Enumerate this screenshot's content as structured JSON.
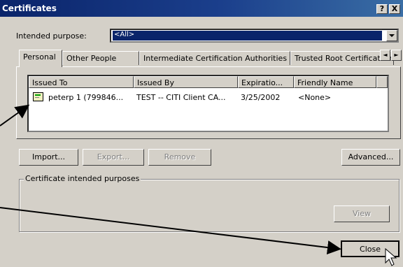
{
  "window": {
    "title": "Certificates",
    "help_label": "?",
    "close_label": "X"
  },
  "purpose": {
    "label": "Intended purpose:",
    "value": "<All>"
  },
  "tabs": [
    {
      "label": "Personal",
      "active": true
    },
    {
      "label": "Other People"
    },
    {
      "label": "Intermediate Certification Authorities"
    },
    {
      "label": "Trusted Root Certification"
    }
  ],
  "tab_scroll": {
    "left": "◄",
    "right": "►"
  },
  "table": {
    "columns": [
      "Issued To",
      "Issued By",
      "Expiratio...",
      "Friendly Name"
    ],
    "rows": [
      {
        "issued_to": "peterp 1 (799846...",
        "issued_by": "TEST -- CITI Client CA...",
        "expiration": "3/25/2002",
        "friendly_name": "<None>",
        "icon": "certificate-icon"
      }
    ]
  },
  "buttons": {
    "import": "Import...",
    "export": "Export...",
    "remove": "Remove",
    "advanced": "Advanced...",
    "view": "View",
    "close": "Close"
  },
  "group": {
    "label": "Certificate intended purposes"
  },
  "colors": {
    "titlebar": "#0a246a",
    "face": "#d4d0c8",
    "selection": "#0a246a"
  }
}
